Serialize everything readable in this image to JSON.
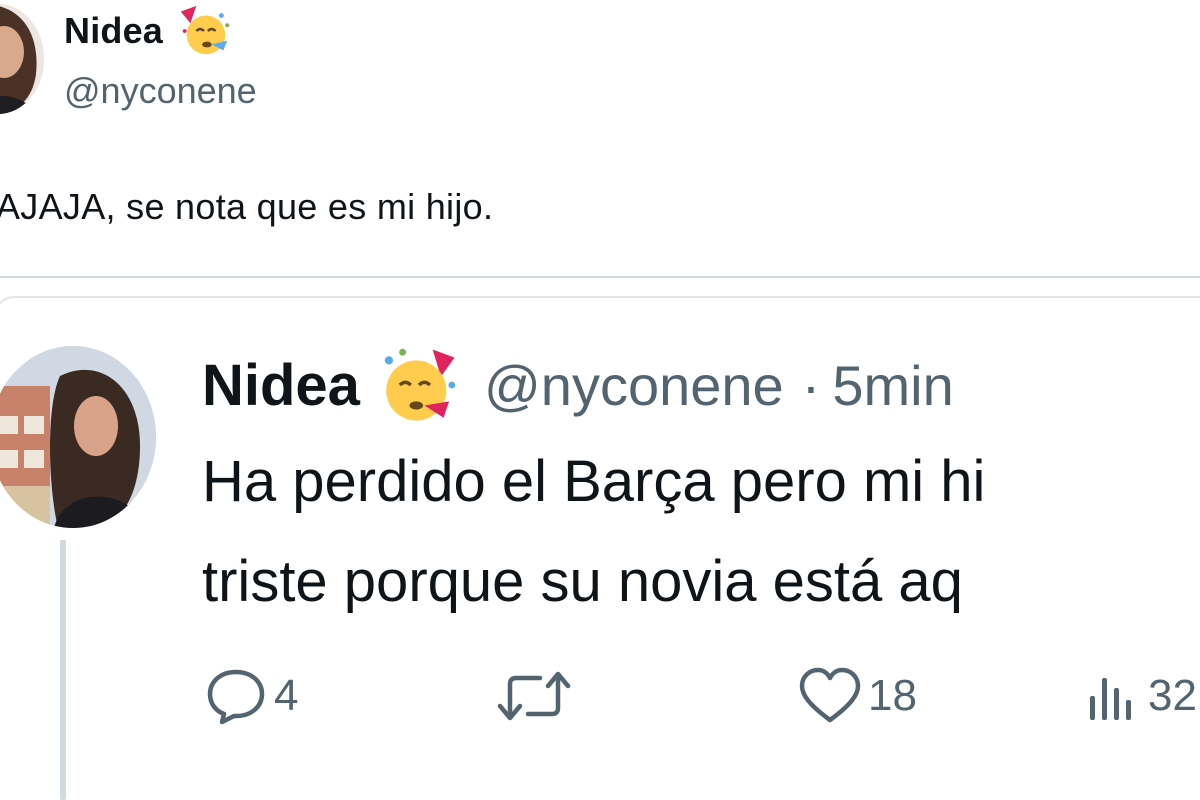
{
  "top_tweet": {
    "author_name": "Nidea",
    "author_handle": "@nyconene",
    "name_emoji": "party-face-emoji",
    "text": "AJAJA, se nota que es mi hijo."
  },
  "quoted_tweet": {
    "author_name": "Nidea",
    "name_emoji": "party-face-emoji",
    "author_handle": "@nyconene",
    "separator": "·",
    "time": "5min",
    "text_lines": [
      "Ha perdido el Barça pero mi hi",
      "triste porque su novia está aq"
    ],
    "actions": {
      "reply": {
        "icon": "reply-icon",
        "count": "4"
      },
      "retweet": {
        "icon": "retweet-icon",
        "count": ""
      },
      "like": {
        "icon": "heart-icon",
        "count": "18"
      },
      "views": {
        "icon": "views-icon",
        "count": "32"
      }
    }
  },
  "colors": {
    "text_primary": "#0f1419",
    "text_secondary": "#536471",
    "border": "#cfd9de"
  }
}
